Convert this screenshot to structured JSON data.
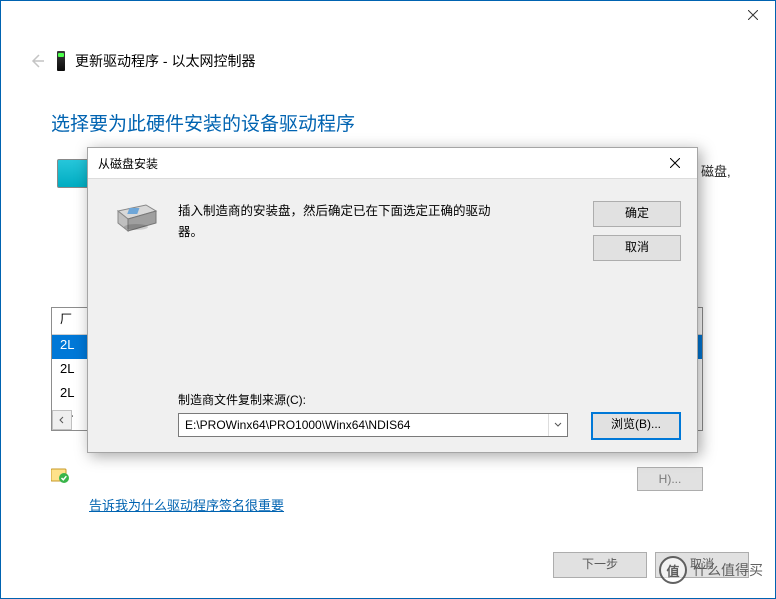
{
  "window": {
    "title_prefix": "更新驱动程序",
    "title_suffix": "以太网控制器"
  },
  "section_title": "选择要为此硬件安装的设备驱动程序",
  "truncated_hint": "磁盘,",
  "list": {
    "header": "厂",
    "rows": [
      "2L",
      "2L",
      "2L",
      "Aŀ"
    ]
  },
  "bg_h_button": "H)...",
  "signing_link": "告诉我为什么驱动程序签名很重要",
  "bottom_buttons": {
    "next": "下一步",
    "cancel": "取消"
  },
  "dlg": {
    "title": "从磁盘安装",
    "message": "插入制造商的安装盘，然后确定已在下面选定正确的驱动器。",
    "ok": "确定",
    "cancel": "取消",
    "copy_from_label": "制造商文件复制来源(C):",
    "path": "E:\\PROWinx64\\PRO1000\\Winx64\\NDIS64",
    "browse": "浏览(B)..."
  },
  "watermark": {
    "char": "值",
    "text": "什么值得买"
  }
}
